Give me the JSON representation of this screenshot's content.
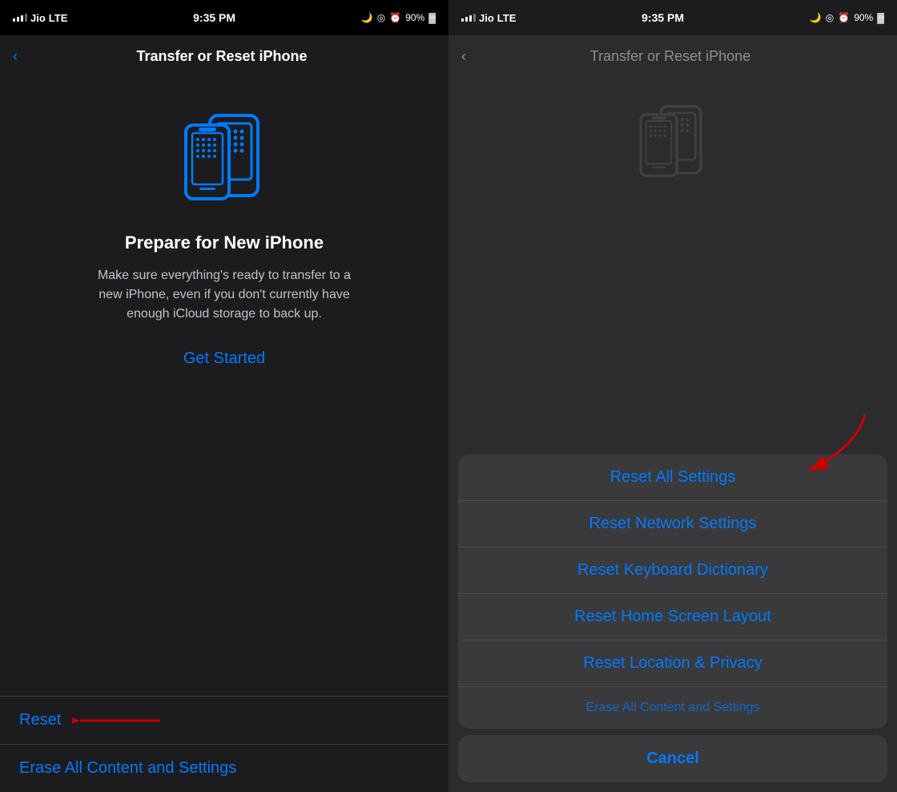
{
  "left": {
    "statusBar": {
      "carrier": "Jio",
      "network": "LTE",
      "time": "9:35 PM",
      "battery": "90%"
    },
    "navTitle": "Transfer or Reset iPhone",
    "phoneIllustration": "phones-transfer-icon",
    "prepareTitle": "Prepare for New iPhone",
    "prepareBody": "Make sure everything's ready to transfer to a new iPhone, even if you don't currently have enough iCloud storage to back up.",
    "getStartedLabel": "Get Started",
    "menuItems": [
      {
        "label": "Reset"
      },
      {
        "label": "Erase All Content and Settings"
      }
    ]
  },
  "right": {
    "statusBar": {
      "carrier": "Jio",
      "network": "LTE",
      "time": "9:35 PM",
      "battery": "90%"
    },
    "navTitle": "Transfer or Reset iPhone",
    "resetOptions": [
      {
        "label": "Reset All Settings"
      },
      {
        "label": "Reset Network Settings"
      },
      {
        "label": "Reset Keyboard Dictionary"
      },
      {
        "label": "Reset Home Screen Layout"
      },
      {
        "label": "Reset Location & Privacy"
      },
      {
        "label": "Erase All Content and Settings"
      }
    ],
    "cancelLabel": "Cancel"
  }
}
